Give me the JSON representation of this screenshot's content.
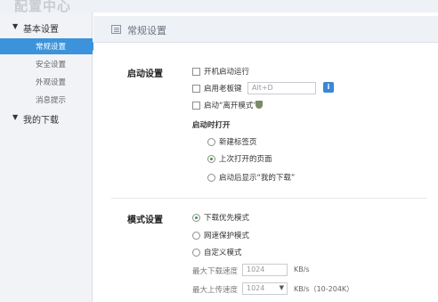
{
  "app": {
    "title": "配置中心"
  },
  "sidebar": {
    "groups": [
      {
        "label": "基本设置",
        "items": [
          {
            "label": "常规设置"
          },
          {
            "label": "安全设置"
          },
          {
            "label": "外观设置"
          },
          {
            "label": "消息提示"
          }
        ]
      },
      {
        "label": "我的下载"
      }
    ],
    "active_item": "常规设置"
  },
  "main": {
    "header_title": "常规设置",
    "startup": {
      "label": "启动设置",
      "options": [
        {
          "label": "开机启动运行",
          "checked": false
        },
        {
          "label": "启用老板键",
          "checked": false
        },
        {
          "label": "启动“离开模式”",
          "checked": false
        }
      ],
      "boss_key_value": "Alt+D",
      "info_button": "i",
      "open_label": "启动时打开",
      "open_options": [
        {
          "label": "新建标签页",
          "selected": false
        },
        {
          "label": "上次打开的页面",
          "selected": true
        },
        {
          "label": "启动后显示“我的下载”",
          "selected": false
        }
      ]
    },
    "mode": {
      "label": "模式设置",
      "options": [
        {
          "label": "下载优先模式",
          "selected": true
        },
        {
          "label": "网速保护模式",
          "selected": false
        },
        {
          "label": "自定义模式",
          "selected": false
        }
      ],
      "max_download_label": "最大下载速度",
      "max_download_value": "1024",
      "max_download_unit": "KB/s",
      "max_upload_label": "最大上传速度",
      "max_upload_value": "1024",
      "max_upload_unit": "KB/s（10-204K）"
    }
  },
  "colors": {
    "accent": "#3c93db",
    "sidebar_bg": "#f1f3f6",
    "radio_on": "#3a9a3a"
  }
}
